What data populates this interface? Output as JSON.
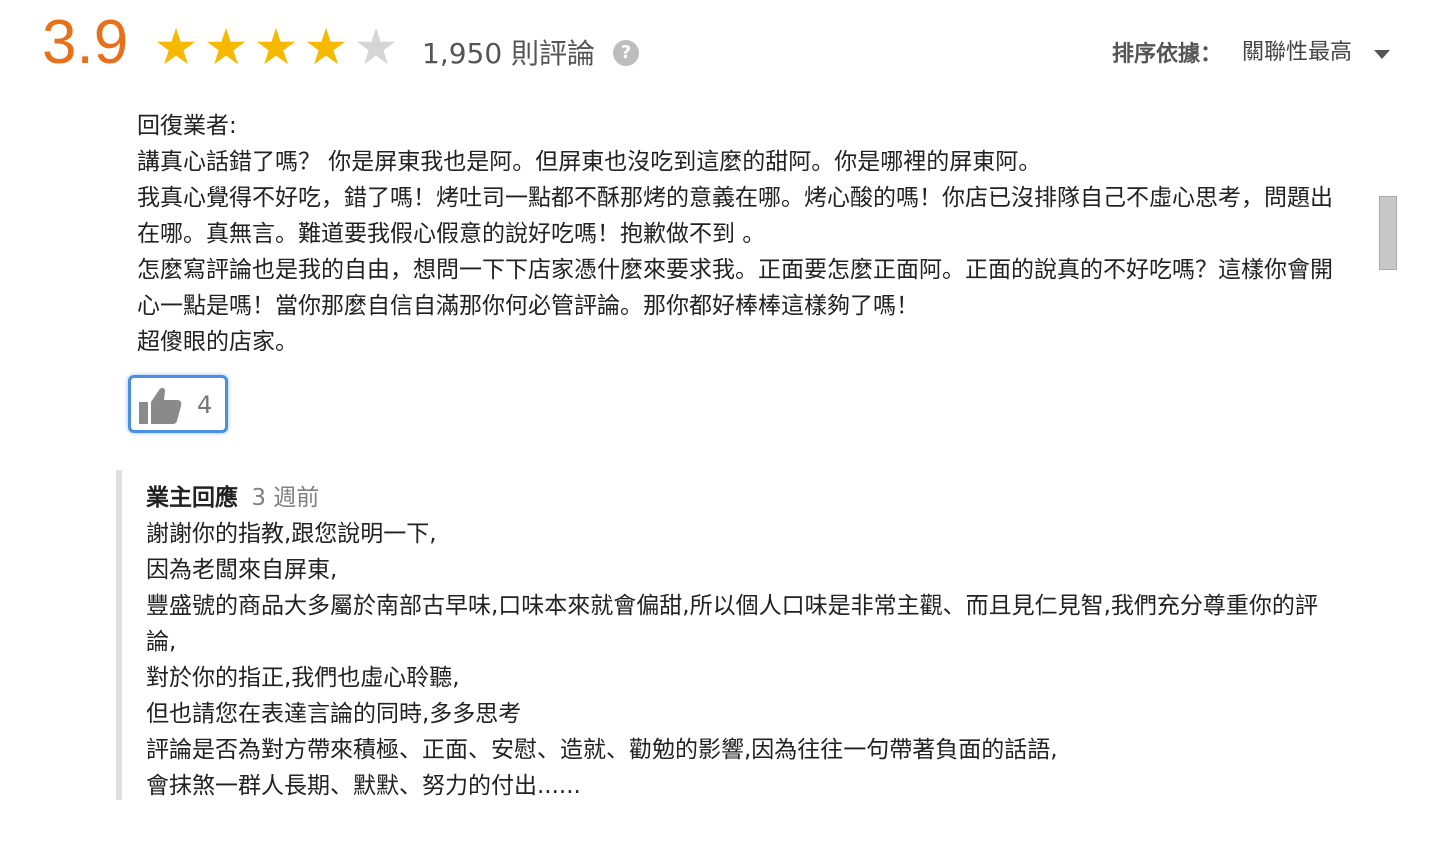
{
  "summary": {
    "score": "3.9",
    "stars": {
      "filled": 4,
      "total": 5
    },
    "review_count": "1,950 則評論",
    "help_icon": "question-mark-icon"
  },
  "sort": {
    "label": "排序依據：",
    "value": "關聯性最高"
  },
  "review": {
    "lines": [
      "回復業者:",
      "講真心話錯了嗎？  你是屏東我也是阿。但屏東也沒吃到這麼的甜阿。你是哪裡的屏東阿。",
      "我真心覺得不好吃，錯了嗎！烤吐司一點都不酥那烤的意義在哪。烤心酸的嗎！你店已沒排隊自己不虛心思考，問題出在哪。真無言。難道要我假心假意的說好吃嗎！抱歉做不到 。",
      "怎麼寫評論也是我的自由，想問一下下店家憑什麼來要求我。正面要怎麼正面阿。正面的說真的不好吃嗎？這樣你會開心一點是嗎！當你那麼自信自滿那你何必管評論。那你都好棒棒這樣夠了嗎！",
      "超傻眼的店家。"
    ],
    "like_count": "4"
  },
  "owner_reply": {
    "label": "業主回應",
    "time": "3 週前",
    "lines": [
      "謝謝你的指教,跟您說明一下,",
      "因為老闆來自屏東,",
      "豐盛號的商品大多屬於南部古早味,口味本來就會偏甜,所以個人口味是非常主觀、而且見仁見智,我們充分尊重你的評論,",
      "對於你的指正,我們也虛心聆聽,",
      "但也請您在表達言論的同時,多多思考",
      "評論是否為對方帶來積極、正面、安慰、造就、勸勉的影響,因為往往一句帶著負面的話語,",
      "會抹煞一群人長期、默默、努力的付出......"
    ]
  },
  "colors": {
    "score": "#e7711b",
    "star_filled": "#f6b900",
    "star_empty": "#d5d5d5",
    "like_border": "#4a90e2"
  }
}
